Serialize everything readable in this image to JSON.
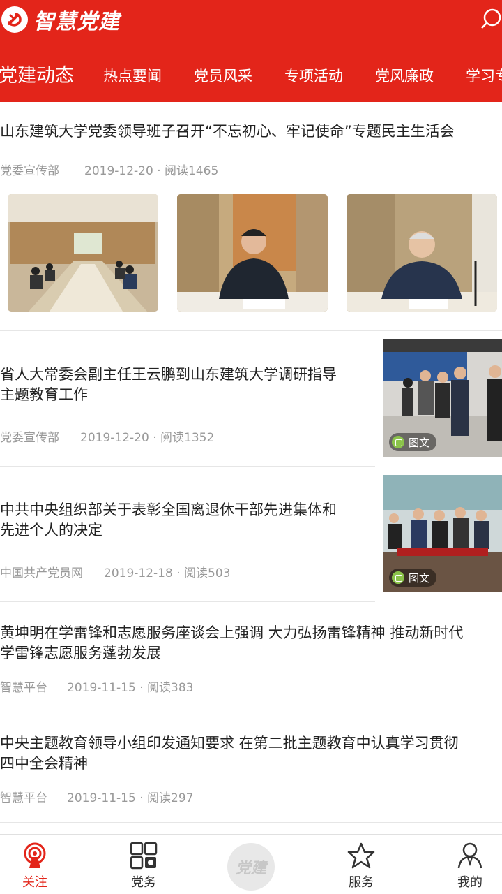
{
  "app": {
    "title": "智慧党建",
    "brand_color": "#e3251a",
    "icons": {
      "logo": "party-emblem-icon",
      "search": "search-icon"
    }
  },
  "tabs": [
    {
      "label": "党建动态",
      "active": true
    },
    {
      "label": "热点要闻"
    },
    {
      "label": "党员风采"
    },
    {
      "label": "专项活动"
    },
    {
      "label": "党风廉政"
    },
    {
      "label": "学习专"
    }
  ],
  "articles": [
    {
      "title": "山东建筑大学党委领导班子召开“不忘初心、牢记使命”专题民主生活会",
      "source": "党委宣传部",
      "date": "2019-12-20",
      "reads": "阅读1465",
      "layout": "three-images"
    },
    {
      "title_lines": [
        "省人大常委会副主任王云鹏到山东建筑大学调研指导",
        "主题教育工作"
      ],
      "source": "党委宣传部",
      "date": "2019-12-20",
      "reads": "阅读1352",
      "badge": "图文"
    },
    {
      "title_lines": [
        "中共中央组织部关于表彰全国离退休干部先进集体和",
        "先进个人的决定"
      ],
      "source": "中国共产党员网",
      "date": "2019-12-18",
      "reads": "阅读503",
      "badge": "图文"
    },
    {
      "title_lines": [
        "黄坤明在学雷锋和志愿服务座谈会上强调 大力弘扬雷锋精神 推动新时代",
        "学雷锋志愿服务蓬勃发展"
      ],
      "source": "智慧平台",
      "date": "2019-11-15",
      "reads": "阅读383"
    },
    {
      "title_lines": [
        "中央主题教育领导小组印发通知要求 在第二批主题教育中认真学习贯彻",
        "四中全会精神"
      ],
      "source": "智慧平台",
      "date": "2019-11-15",
      "reads": "阅读297"
    }
  ],
  "tabbar": {
    "items": [
      {
        "label": "关注",
        "icon": "broadcast-icon",
        "active": true
      },
      {
        "label": "党务",
        "icon": "grid-icon"
      },
      {
        "label": "党建",
        "icon": "party-building-center-icon"
      },
      {
        "label": "服务",
        "icon": "star-icon"
      },
      {
        "label": "我的",
        "icon": "user-icon"
      }
    ]
  }
}
